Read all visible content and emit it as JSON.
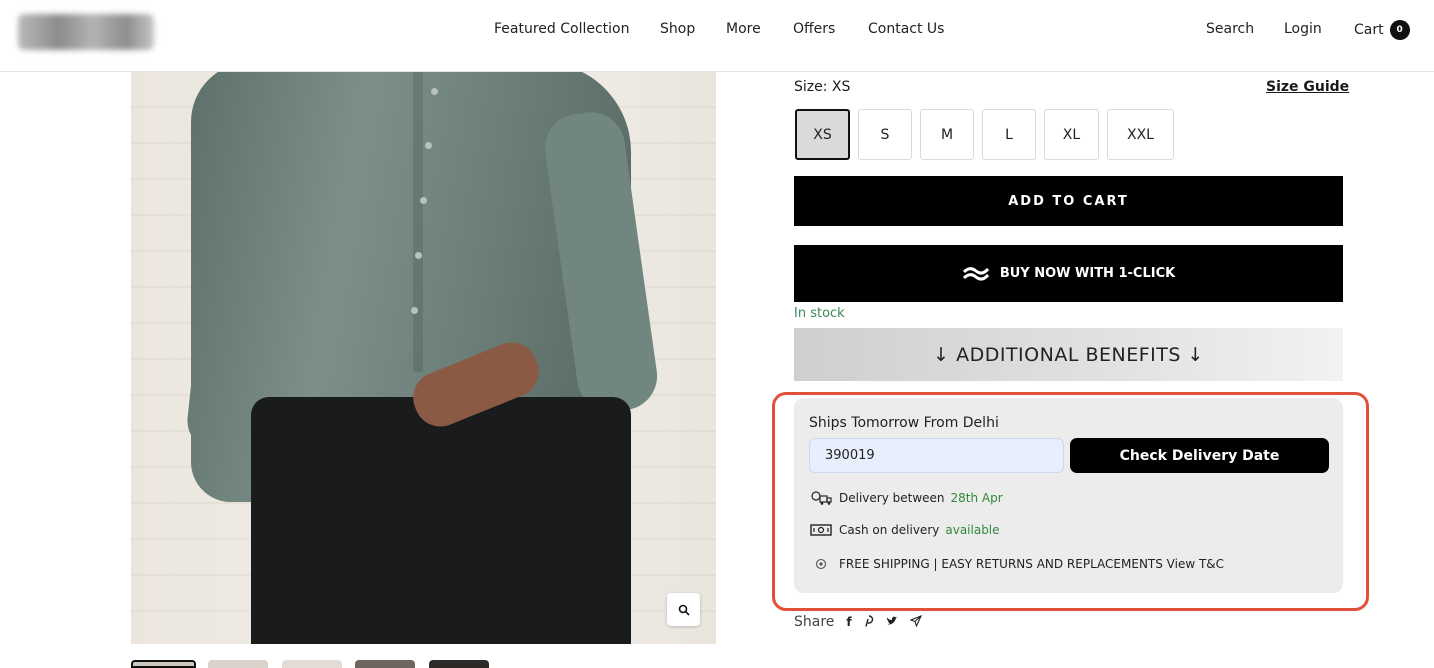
{
  "header": {
    "nav": [
      "Featured Collection",
      "Shop",
      "More",
      "Offers",
      "Contact Us"
    ],
    "search": "Search",
    "login": "Login",
    "cart": "Cart",
    "cart_count": "0"
  },
  "product": {
    "size_label": "Size: XS",
    "size_guide": "Size Guide",
    "sizes": [
      "XS",
      "S",
      "M",
      "L",
      "XL",
      "XXL"
    ],
    "selected_size": "XS",
    "add_to_cart": "ADD TO CART",
    "buy_now": "BUY NOW WITH 1-CLICK",
    "stock": "In stock",
    "benefits": "↓ ADDITIONAL BENEFITS ↓"
  },
  "delivery": {
    "ships": "Ships Tomorrow From Delhi",
    "pincode": "390019",
    "check_button": "Check Delivery Date",
    "delivery_prefix": "Delivery between",
    "delivery_date": "28th Apr",
    "cod_prefix": "Cash on delivery",
    "cod_status": "available",
    "shipping_text": "FREE SHIPPING | EASY RETURNS AND REPLACEMENTS View T&C"
  },
  "share": {
    "label": "Share"
  },
  "colors": {
    "accent_highlight": "#e0503a",
    "stock_green": "#3a8a5a",
    "button_black": "#000000"
  }
}
